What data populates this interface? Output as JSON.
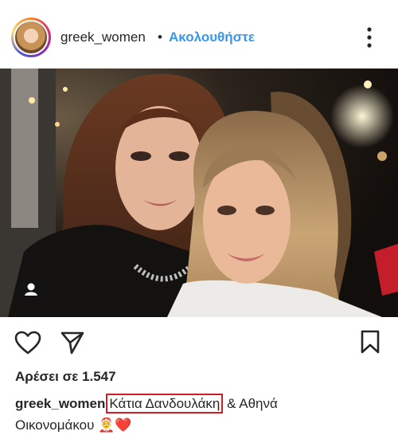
{
  "header": {
    "username": "greek_women",
    "separator": "•",
    "follow_label": "Ακολουθήστε"
  },
  "post": {
    "likes_text": "Αρέσει σε 1.547",
    "caption": {
      "username": "greek_women",
      "mention_1": "Κάτια Δανδουλάκη",
      "joiner": "& Αθηνά",
      "line2_text": "Οικονομάκου",
      "emoji": "🤶❤️"
    }
  },
  "icons": [
    "more-options-icon",
    "heart-icon",
    "send-icon",
    "bookmark-icon",
    "person-tag-icon"
  ],
  "colors": {
    "follow_blue": "#3897f0",
    "highlight_red": "#d01c24"
  }
}
